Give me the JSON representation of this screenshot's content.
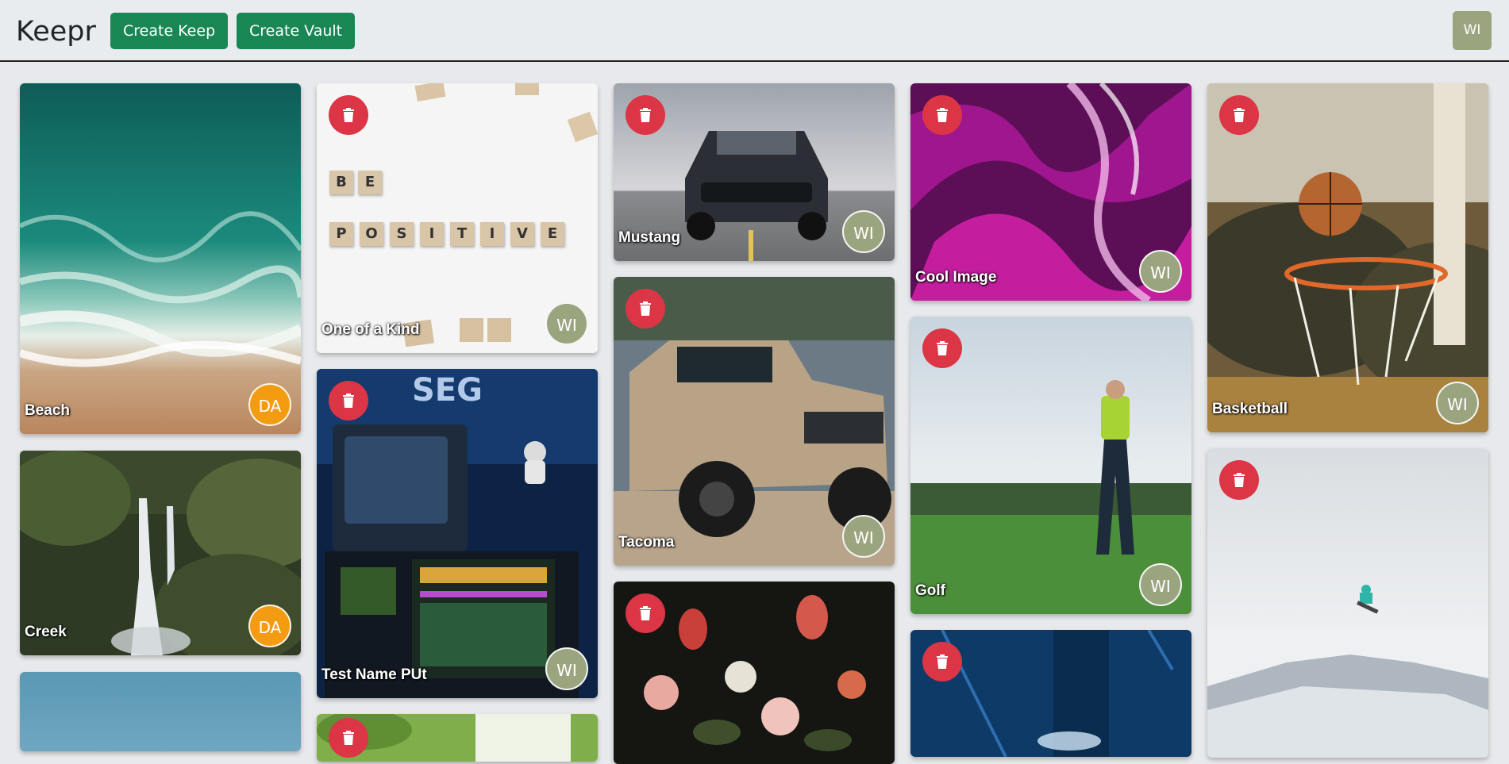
{
  "nav": {
    "brand": "Keepr",
    "create_keep": "Create Keep",
    "create_vault": "Create Vault",
    "user_initials": "WI"
  },
  "cards": {
    "beach": {
      "title": "Beach",
      "owner": "DA"
    },
    "creek": {
      "title": "Creek",
      "owner": "DA"
    },
    "one_of_a_kind": {
      "title": "One of a Kind",
      "owner": "WI"
    },
    "test_name": {
      "title": "Test Name PUt",
      "owner": "WI"
    },
    "mustang": {
      "title": "Mustang",
      "owner": "WI"
    },
    "tacoma": {
      "title": "Tacoma",
      "owner": "WI"
    },
    "flowers": {
      "title": "",
      "owner": ""
    },
    "cool_image": {
      "title": "Cool Image",
      "owner": "WI"
    },
    "golf": {
      "title": "Golf",
      "owner": "WI"
    },
    "pool": {
      "title": "",
      "owner": ""
    },
    "basketball": {
      "title": "Basketball",
      "owner": "WI"
    },
    "snowboard": {
      "title": "",
      "owner": ""
    }
  },
  "scrabble_tiles": {
    "row1": [
      "B",
      "E"
    ],
    "row2": [
      "P",
      "O",
      "S",
      "I",
      "T",
      "I",
      "V",
      "E"
    ]
  },
  "colors": {
    "primary_button": "#198754",
    "danger_button": "#dc3545",
    "avatar_wi": "#9aa580",
    "avatar_da": "#f39c12"
  },
  "icons": {
    "delete": "trash-icon"
  }
}
